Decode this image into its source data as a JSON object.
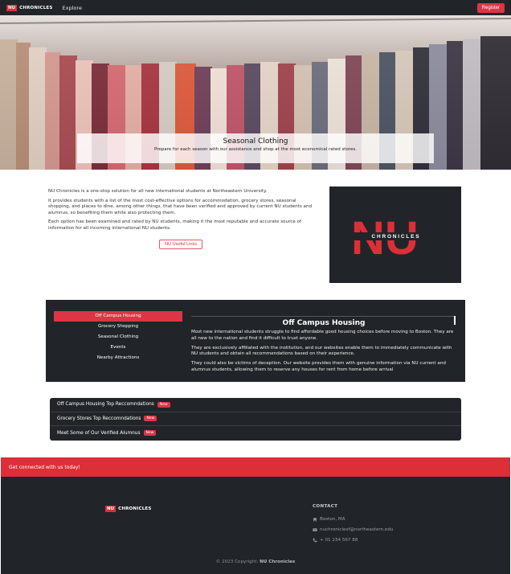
{
  "navbar": {
    "logo_box": "NU",
    "logo_text": "CHRONICLES",
    "explore_label": "Explore",
    "register_label": "Register"
  },
  "hero": {
    "title": "Seasonal Clothing",
    "subtitle": "Prepare for each season with our assistance and shop at the most economical rated stores."
  },
  "about": {
    "paragraphs": [
      "NU Chronicles is a one-stop solution for all new international students at Northeastern University.",
      "It provides students with a list of the most cost-effective options for accommodation, grocery stores, seasonal shopping, and places to dine, among other things, that have been verified and approved by current NU students and alumnus, so benefiting them while also protecting them.",
      "Each option has been examined and rated by NU students, making it the most reputable and accurate source of information for all incoming international NU students."
    ],
    "useful_links_label": "NU Useful Links"
  },
  "brand_panel": {
    "big_letters": "NU",
    "word": "C H R O N I C L E S"
  },
  "tabs": {
    "items": [
      {
        "label": "Off Campus Housing"
      },
      {
        "label": "Grocery Shopping"
      },
      {
        "label": "Seasonal Clothing"
      },
      {
        "label": "Events"
      },
      {
        "label": "Nearby Attractions"
      }
    ],
    "active_title": "Off Campus Housing",
    "body": [
      "Most new international students struggle to find affordable good housing choices before moving to Boston. They are all new to the nation and find it difficult to trust anyone.",
      "They are exclusively affiliated with the institution, and our websites enable them to immediately communicate with NU students and obtain all recommendations based on their experience.",
      "They could also be victims of deception. Our website provides them with genuine information via NU current and alumnus students, allowing them to reserve any houses for rent from home before arrival"
    ]
  },
  "accordion": {
    "items": [
      {
        "label": "Off Campus Housing Top Reccomndations",
        "badge": "New"
      },
      {
        "label": "Grocery Stores Top Reccomndations",
        "badge": "New"
      },
      {
        "label": "Meet Some of Our Verified Alumnus",
        "badge": "New"
      }
    ]
  },
  "cta": {
    "text": "Get connected with us today!"
  },
  "footer": {
    "logo_box": "NU",
    "logo_text": "CHRONICLES",
    "contact_heading": "CONTACT",
    "location": "Boston, MA",
    "email": "nuchroniclesf@northeastern.edu",
    "phone": "+ 01 234 567 88",
    "copyright_prefix": "© 2023 Copyright:",
    "copyright_brand": "NU Chronicles"
  },
  "colors": {
    "brand_red": "#dc3545",
    "dark": "#212529"
  }
}
